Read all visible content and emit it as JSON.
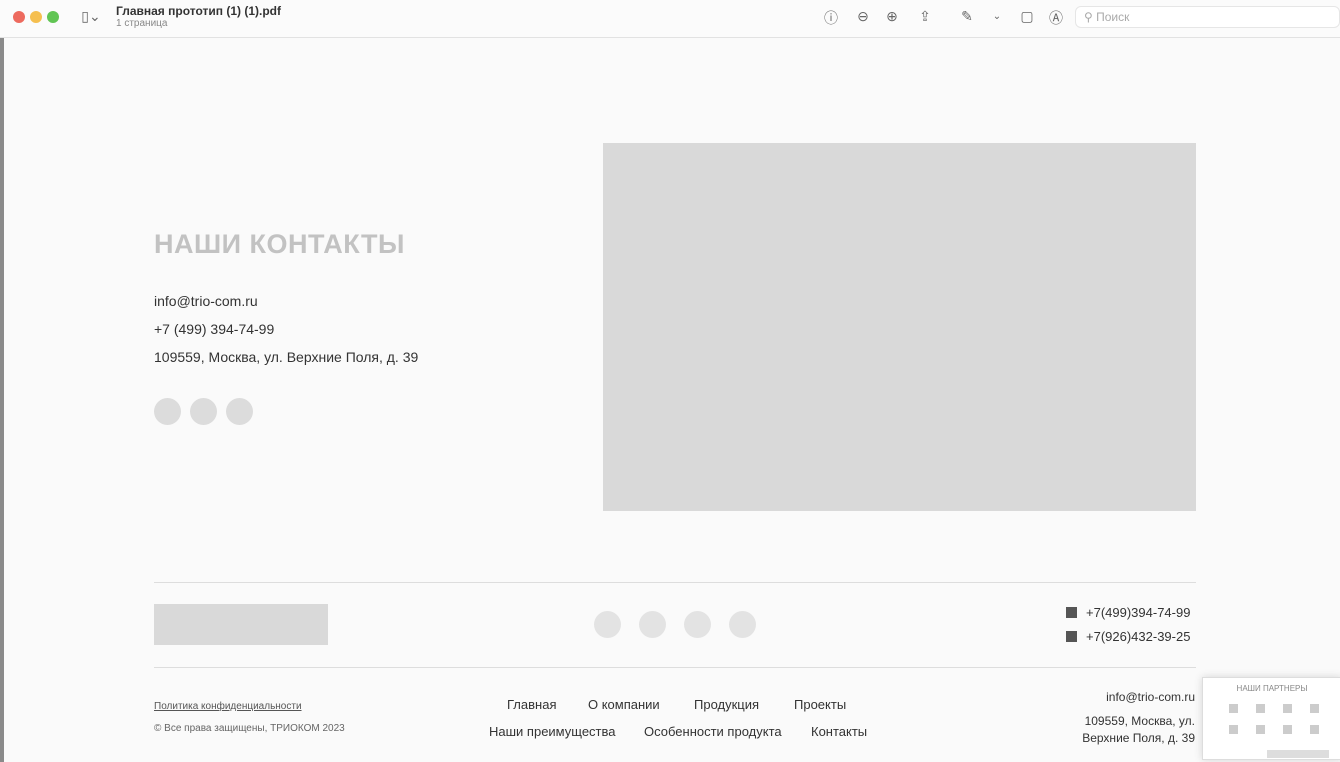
{
  "window": {
    "title": "Главная прототип (1) (1).pdf",
    "subtitle": "1 страница",
    "search_placeholder": "Поиск",
    "colors": {
      "close": "#ed6a5e",
      "minimize": "#f5bf4f",
      "zoom": "#61c554"
    }
  },
  "toolbar": {
    "icons": [
      "sidebar-icon",
      "info-icon",
      "zoom-out-icon",
      "zoom-in-icon",
      "share-icon",
      "markup-pen-icon",
      "chevron-down-icon",
      "rotate-icon",
      "annotate-icon",
      "search-icon"
    ]
  },
  "contacts": {
    "heading": "НАШИ КОНТАКТЫ",
    "email": "info@trio-com.ru",
    "phone": "+7 (499) 394-74-99",
    "address": "109559, Москва, ул. Верхние Поля, д. 39"
  },
  "footer": {
    "phones": [
      "+7(499)394-74-99",
      "+7(926)432-39-25"
    ],
    "privacy": "Политика конфиденциальности",
    "copyright": "© Все права защищены, ТРИОКОМ 2023",
    "nav_row1": [
      "Главная",
      "О компании",
      "Продукция",
      "Проекты"
    ],
    "nav_row2": [
      "Наши преимущества",
      "Особенности продукта",
      "Контакты"
    ],
    "email": "info@trio-com.ru",
    "address_line1": "109559, Москва, ул.",
    "address_line2": "Верхние Поля, д. 39"
  },
  "thumbnail": {
    "heading": "НАШИ ПАРТНЕРЫ"
  }
}
